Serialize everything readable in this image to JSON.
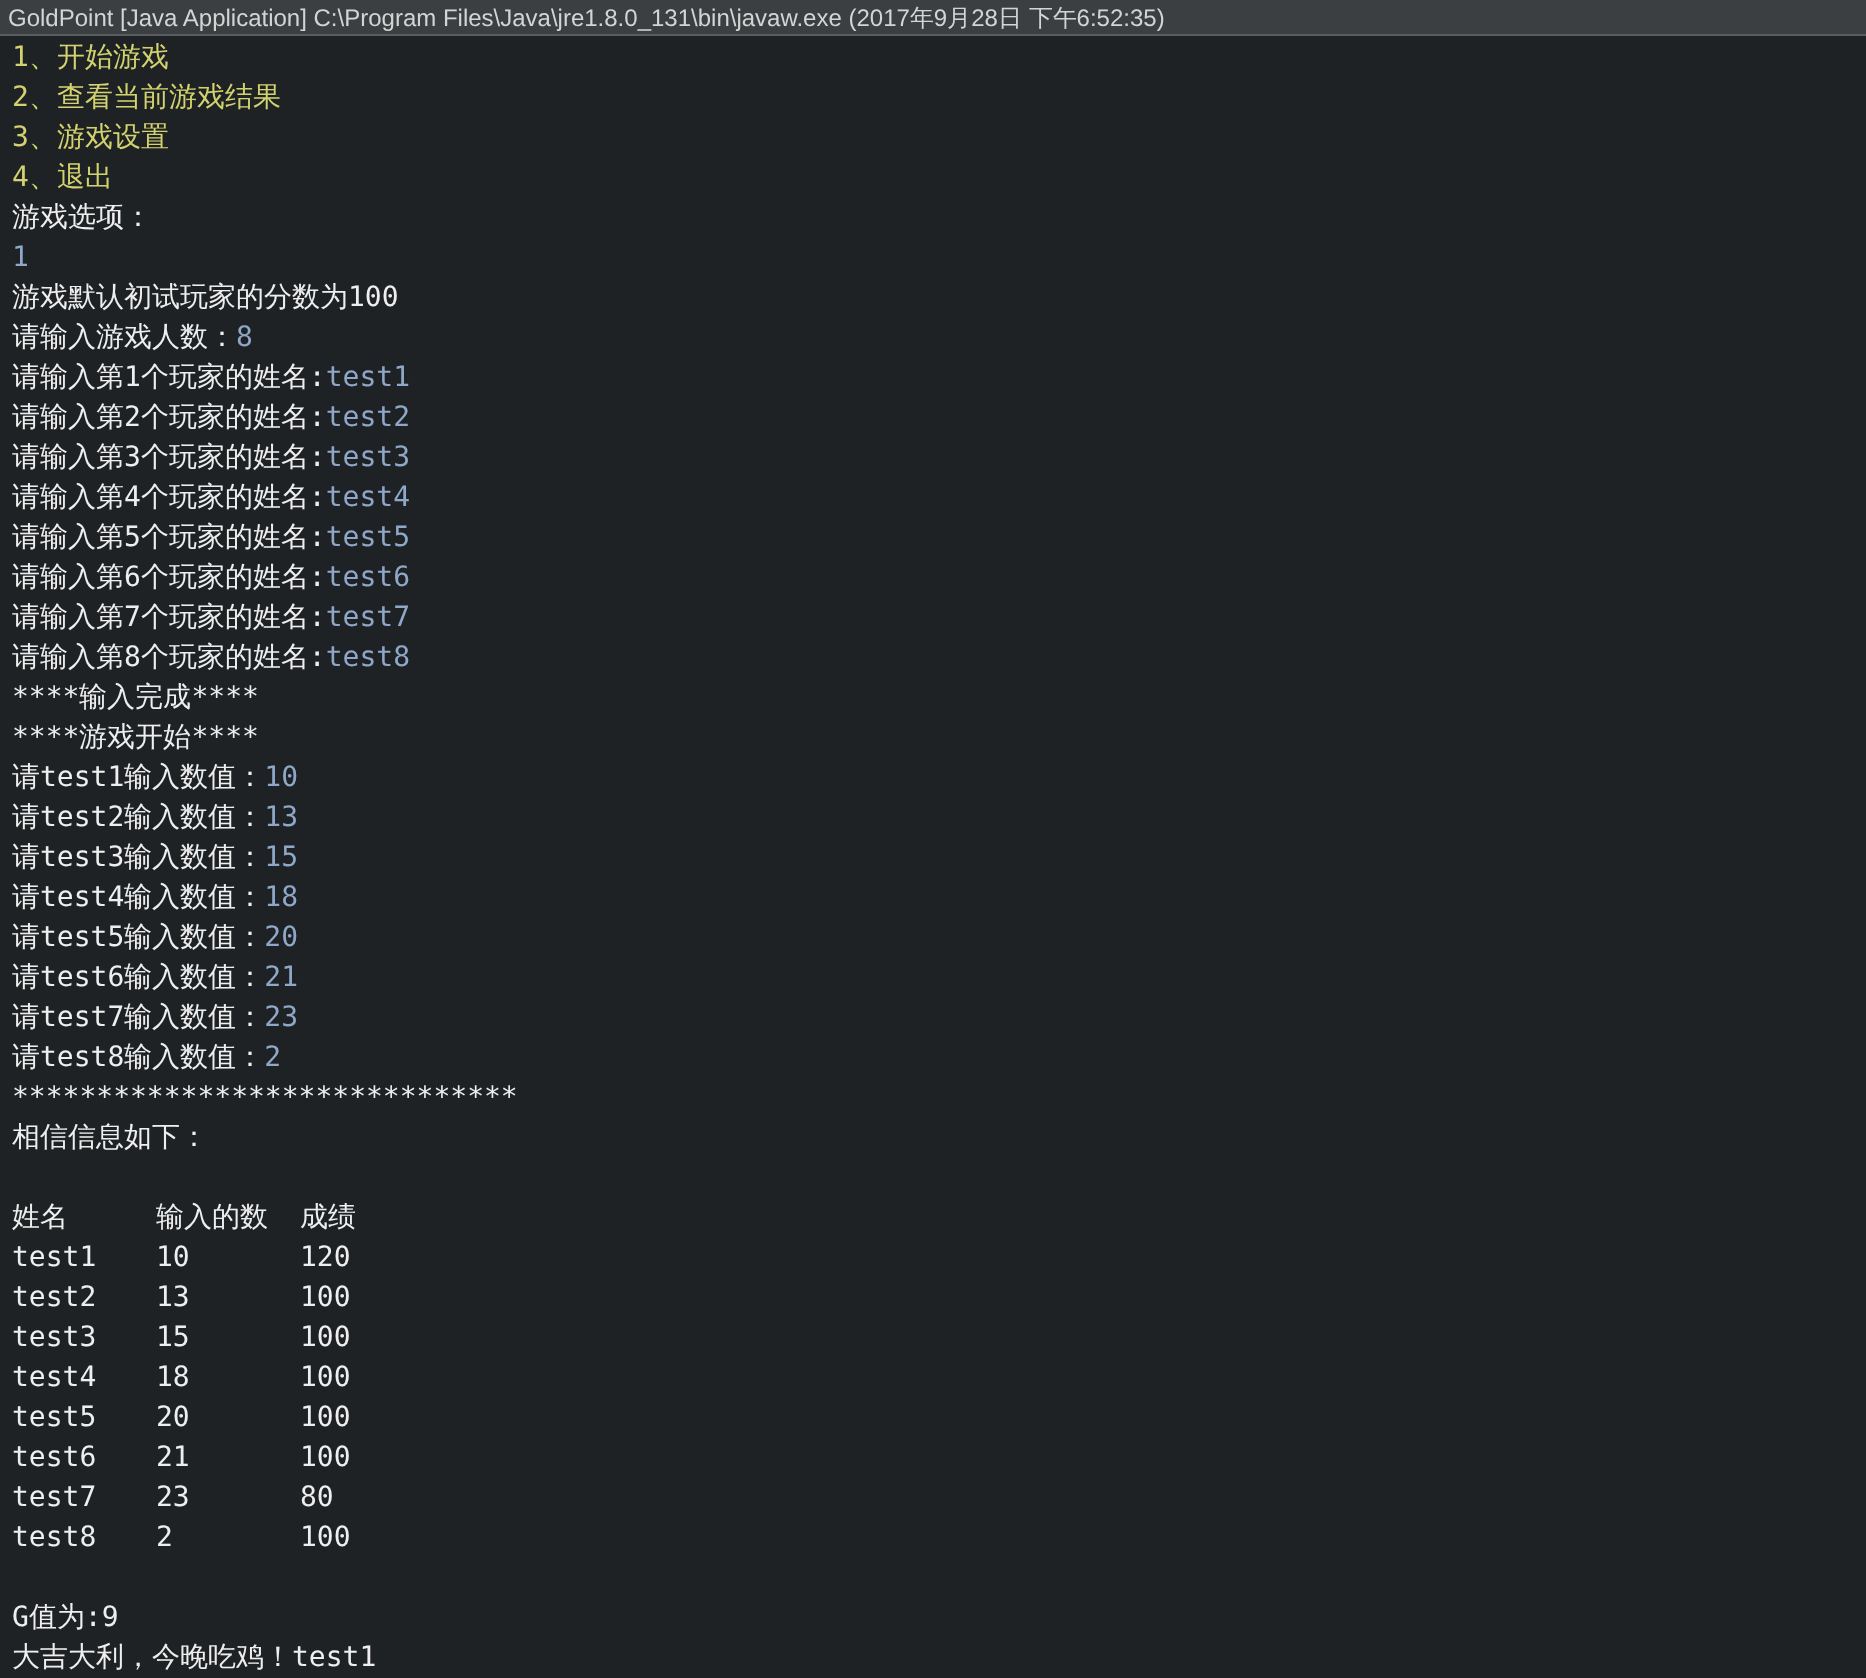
{
  "window": {
    "title": "GoldPoint [Java Application] C:\\Program Files\\Java\\jre1.8.0_131\\bin\\javaw.exe (2017年9月28日 下午6:52:35)"
  },
  "console": {
    "lines_before": [
      {
        "segments": [
          {
            "kind": "option",
            "text": "1、开始游戏"
          }
        ]
      },
      {
        "segments": [
          {
            "kind": "option",
            "text": "2、查看当前游戏结果"
          }
        ]
      },
      {
        "segments": [
          {
            "kind": "option",
            "text": "3、游戏设置"
          }
        ]
      },
      {
        "segments": [
          {
            "kind": "option",
            "text": "4、退出"
          }
        ]
      },
      {
        "segments": [
          {
            "kind": "output",
            "text": "游戏选项："
          }
        ]
      },
      {
        "segments": [
          {
            "kind": "input",
            "text": "1"
          }
        ]
      },
      {
        "segments": [
          {
            "kind": "output",
            "text": "游戏默认初试玩家的分数为100"
          }
        ]
      },
      {
        "segments": [
          {
            "kind": "output",
            "text": "请输入游戏人数："
          },
          {
            "kind": "input",
            "text": "8"
          }
        ]
      },
      {
        "segments": [
          {
            "kind": "output",
            "text": "请输入第1个玩家的姓名:"
          },
          {
            "kind": "input",
            "text": "test1"
          }
        ]
      },
      {
        "segments": [
          {
            "kind": "output",
            "text": "请输入第2个玩家的姓名:"
          },
          {
            "kind": "input",
            "text": "test2"
          }
        ]
      },
      {
        "segments": [
          {
            "kind": "output",
            "text": "请输入第3个玩家的姓名:"
          },
          {
            "kind": "input",
            "text": "test3"
          }
        ]
      },
      {
        "segments": [
          {
            "kind": "output",
            "text": "请输入第4个玩家的姓名:"
          },
          {
            "kind": "input",
            "text": "test4"
          }
        ]
      },
      {
        "segments": [
          {
            "kind": "output",
            "text": "请输入第5个玩家的姓名:"
          },
          {
            "kind": "input",
            "text": "test5"
          }
        ]
      },
      {
        "segments": [
          {
            "kind": "output",
            "text": "请输入第6个玩家的姓名:"
          },
          {
            "kind": "input",
            "text": "test6"
          }
        ]
      },
      {
        "segments": [
          {
            "kind": "output",
            "text": "请输入第7个玩家的姓名:"
          },
          {
            "kind": "input",
            "text": "test7"
          }
        ]
      },
      {
        "segments": [
          {
            "kind": "output",
            "text": "请输入第8个玩家的姓名:"
          },
          {
            "kind": "input",
            "text": "test8"
          }
        ]
      },
      {
        "segments": [
          {
            "kind": "output",
            "text": "****输入完成****"
          }
        ]
      },
      {
        "segments": [
          {
            "kind": "output",
            "text": "****游戏开始****"
          }
        ]
      },
      {
        "segments": [
          {
            "kind": "output",
            "text": "请test1输入数值："
          },
          {
            "kind": "input",
            "text": "10"
          }
        ]
      },
      {
        "segments": [
          {
            "kind": "output",
            "text": "请test2输入数值："
          },
          {
            "kind": "input",
            "text": "13"
          }
        ]
      },
      {
        "segments": [
          {
            "kind": "output",
            "text": "请test3输入数值："
          },
          {
            "kind": "input",
            "text": "15"
          }
        ]
      },
      {
        "segments": [
          {
            "kind": "output",
            "text": "请test4输入数值："
          },
          {
            "kind": "input",
            "text": "18"
          }
        ]
      },
      {
        "segments": [
          {
            "kind": "output",
            "text": "请test5输入数值："
          },
          {
            "kind": "input",
            "text": "20"
          }
        ]
      },
      {
        "segments": [
          {
            "kind": "output",
            "text": "请test6输入数值："
          },
          {
            "kind": "input",
            "text": "21"
          }
        ]
      },
      {
        "segments": [
          {
            "kind": "output",
            "text": "请test7输入数值："
          },
          {
            "kind": "input",
            "text": "23"
          }
        ]
      },
      {
        "segments": [
          {
            "kind": "output",
            "text": "请test8输入数值："
          },
          {
            "kind": "input",
            "text": "2"
          }
        ]
      },
      {
        "segments": [
          {
            "kind": "output",
            "text": "******************************"
          }
        ]
      },
      {
        "segments": [
          {
            "kind": "output",
            "text": "相信信息如下："
          }
        ]
      }
    ],
    "table": {
      "columns": [
        "姓名",
        "输入的数",
        "成绩"
      ],
      "rows": [
        [
          "test1",
          "10",
          "120"
        ],
        [
          "test2",
          "13",
          "100"
        ],
        [
          "test3",
          "15",
          "100"
        ],
        [
          "test4",
          "18",
          "100"
        ],
        [
          "test5",
          "20",
          "100"
        ],
        [
          "test6",
          "21",
          "100"
        ],
        [
          "test7",
          "23",
          "80"
        ],
        [
          "test8",
          "2",
          "100"
        ]
      ]
    },
    "lines_after": [
      {
        "segments": [
          {
            "kind": "output",
            "text": "G值为:9"
          }
        ]
      },
      {
        "segments": [
          {
            "kind": "output",
            "text": "大吉大利，今晚吃鸡！test1"
          }
        ]
      }
    ]
  }
}
